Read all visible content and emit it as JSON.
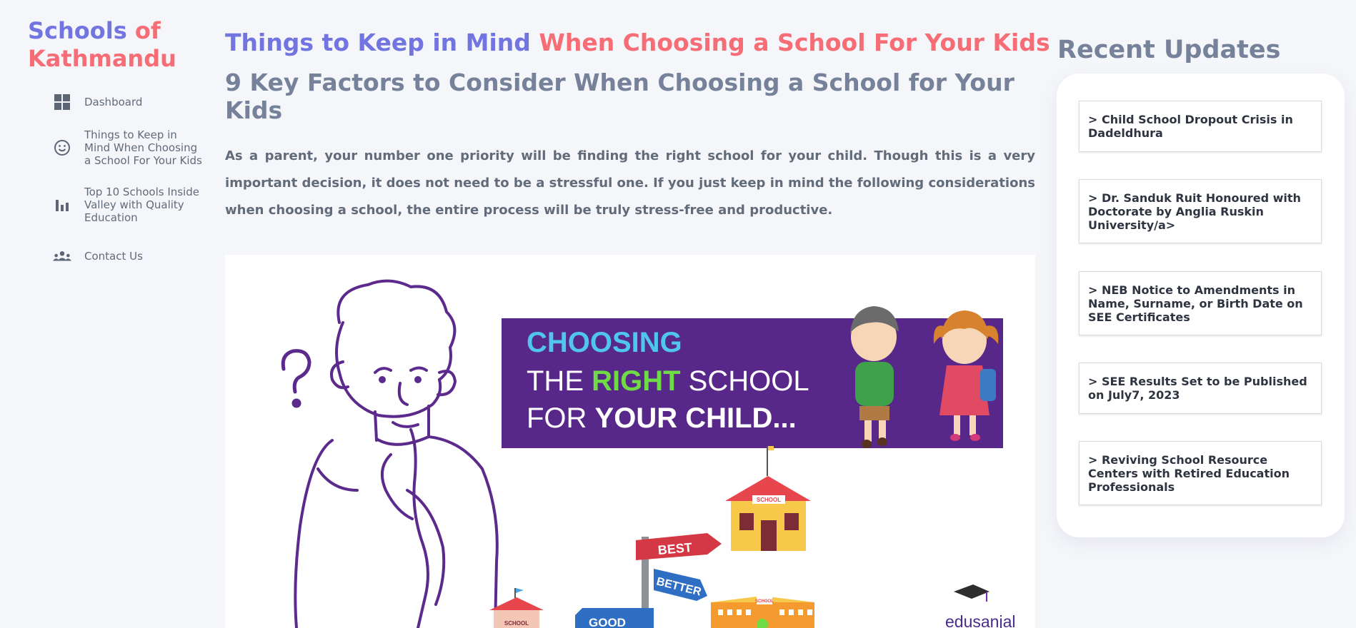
{
  "brand": {
    "part1": "Schools ",
    "part2": "of",
    "part3": "Kathmandu"
  },
  "nav": {
    "items": [
      {
        "icon": "dashboard-icon",
        "label": "Dashboard"
      },
      {
        "icon": "smile-icon",
        "label": "Things to Keep in Mind When Choosing a School For Your Kids"
      },
      {
        "icon": "bar-chart-icon",
        "label": "Top 10 Schools Inside Valley with Quality Education"
      },
      {
        "icon": "contacts-icon",
        "label": "Contact Us"
      }
    ]
  },
  "main": {
    "title_part1": "Things to Keep in Mind",
    "title_part2": "When Choosing a School For Your Kids",
    "subtitle": "9 Key Factors to Consider When Choosing a School for Your Kids",
    "intro": "As a parent, your number one priority will be finding the right school for your child. Though this is a very important decision, it does not need to be a stressful one. If you just keep in mind the following considerations when choosing a school, the entire process will be truly stress-free and productive."
  },
  "hero": {
    "banner_line1": "CHOOSING",
    "banner_line2_a": "THE ",
    "banner_line2_b": "RIGHT",
    "banner_line2_c": " SCHOOL",
    "banner_line3_a": "FOR ",
    "banner_line3_b": "YOUR CHILD...",
    "sign_best": "BEST",
    "sign_better": "BETTER",
    "sign_good": "GOOD",
    "school_label": "SCHOOL",
    "school_small_label": "SCHOOL",
    "school_right_label": "SCHOOL",
    "logo_text": "edusanjal"
  },
  "recent": {
    "title": "Recent Updates",
    "items": [
      "> Child School Dropout Crisis in Dadeldhura",
      "> Dr. Sanduk Ruit Honoured with Doctorate by Anglia Ruskin University/a>",
      "> NEB Notice to Amendments in Name, Surname, or Birth Date on SEE Certificates",
      "> SEE Results Set to be Published on July7, 2023",
      "> Reviving School Resource Centers with Retired Education Professionals"
    ]
  },
  "colors": {
    "accent_blue": "#7275e0",
    "accent_red": "#f66d76",
    "heading_gray": "#76819a",
    "banner_purple": "#58278a",
    "banner_cyan": "#4fc5ef",
    "banner_green": "#6fdc46"
  }
}
